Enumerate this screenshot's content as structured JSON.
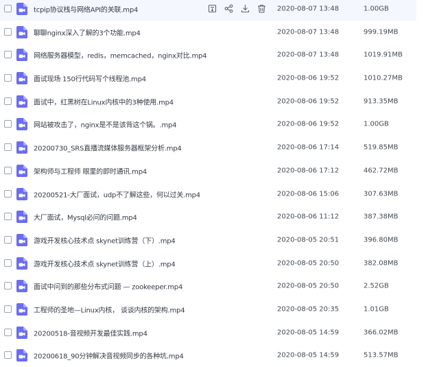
{
  "icons": {
    "file": "video-file-icon",
    "check": "checkbox"
  },
  "colors": {
    "accent": "#6b6df0",
    "hover_row": "#f4f7fd"
  },
  "row_actions": [
    {
      "name": "share-icon",
      "interactable": true
    },
    {
      "name": "link-share-icon",
      "interactable": true
    },
    {
      "name": "download-icon",
      "interactable": true
    },
    {
      "name": "delete-icon",
      "interactable": true
    }
  ],
  "files": [
    {
      "name": "tcpip协议栈与网络API的关联.mp4",
      "date": "2020-08-07 13:48",
      "size": "1.00GB"
    },
    {
      "name": "聊聊nginx深入了解的3个功能.mp4",
      "date": "2020-08-07 13:48",
      "size": "999.19MB"
    },
    {
      "name": "网络服务器模型，redis，memcached，nginx对比.mp4",
      "date": "2020-08-07 13:48",
      "size": "1019.91MB"
    },
    {
      "name": "面试现场 150行代码写个线程池.mp4",
      "date": "2020-08-06 19:52",
      "size": "1010.27MB"
    },
    {
      "name": "面试中，红黑树在Linux内核中的3种使用.mp4",
      "date": "2020-08-06 19:52",
      "size": "913.35MB"
    },
    {
      "name": "网站被攻击了，nginx是不是该背这个锅。.mp4",
      "date": "2020-08-06 19:52",
      "size": "1.00GB"
    },
    {
      "name": "20200730_SRS直播流媒体服务器框架分析.mp4",
      "date": "2020-08-06 17:14",
      "size": "519.85MB"
    },
    {
      "name": "架构师与工程师 眼里的即时通讯.mp4",
      "date": "2020-08-06 17:12",
      "size": "462.72MB"
    },
    {
      "name": "20200521-大厂面试，udp不了解这些，何以过关.mp4",
      "date": "2020-08-06 15:06",
      "size": "307.63MB"
    },
    {
      "name": "大厂面试，Mysql必问的问题.mp4",
      "date": "2020-08-06 11:12",
      "size": "387.38MB"
    },
    {
      "name": "游戏开发核心技术点 skynet训练营（下）.mp4",
      "date": "2020-08-05 20:51",
      "size": "396.80MB"
    },
    {
      "name": "游戏开发核心技术点 skynet训练营（上）.mp4",
      "date": "2020-08-05 20:50",
      "size": "382.08MB"
    },
    {
      "name": "面试中问到的那些分布式问题 — zookeeper.mp4",
      "date": "2020-08-05 20:50",
      "size": "2.52GB"
    },
    {
      "name": "工程师的圣地—Linux内核， 谈谈内核的架构.mp4",
      "date": "2020-08-05 20:35",
      "size": "1.01GB"
    },
    {
      "name": "20200518-音视频开发最佳实践.mp4",
      "date": "2020-08-05 14:59",
      "size": "366.02MB"
    },
    {
      "name": "20200618_90分钟解决音视频同步的各种坑.mp4",
      "date": "2020-08-05 14:59",
      "size": "513.57MB"
    }
  ]
}
